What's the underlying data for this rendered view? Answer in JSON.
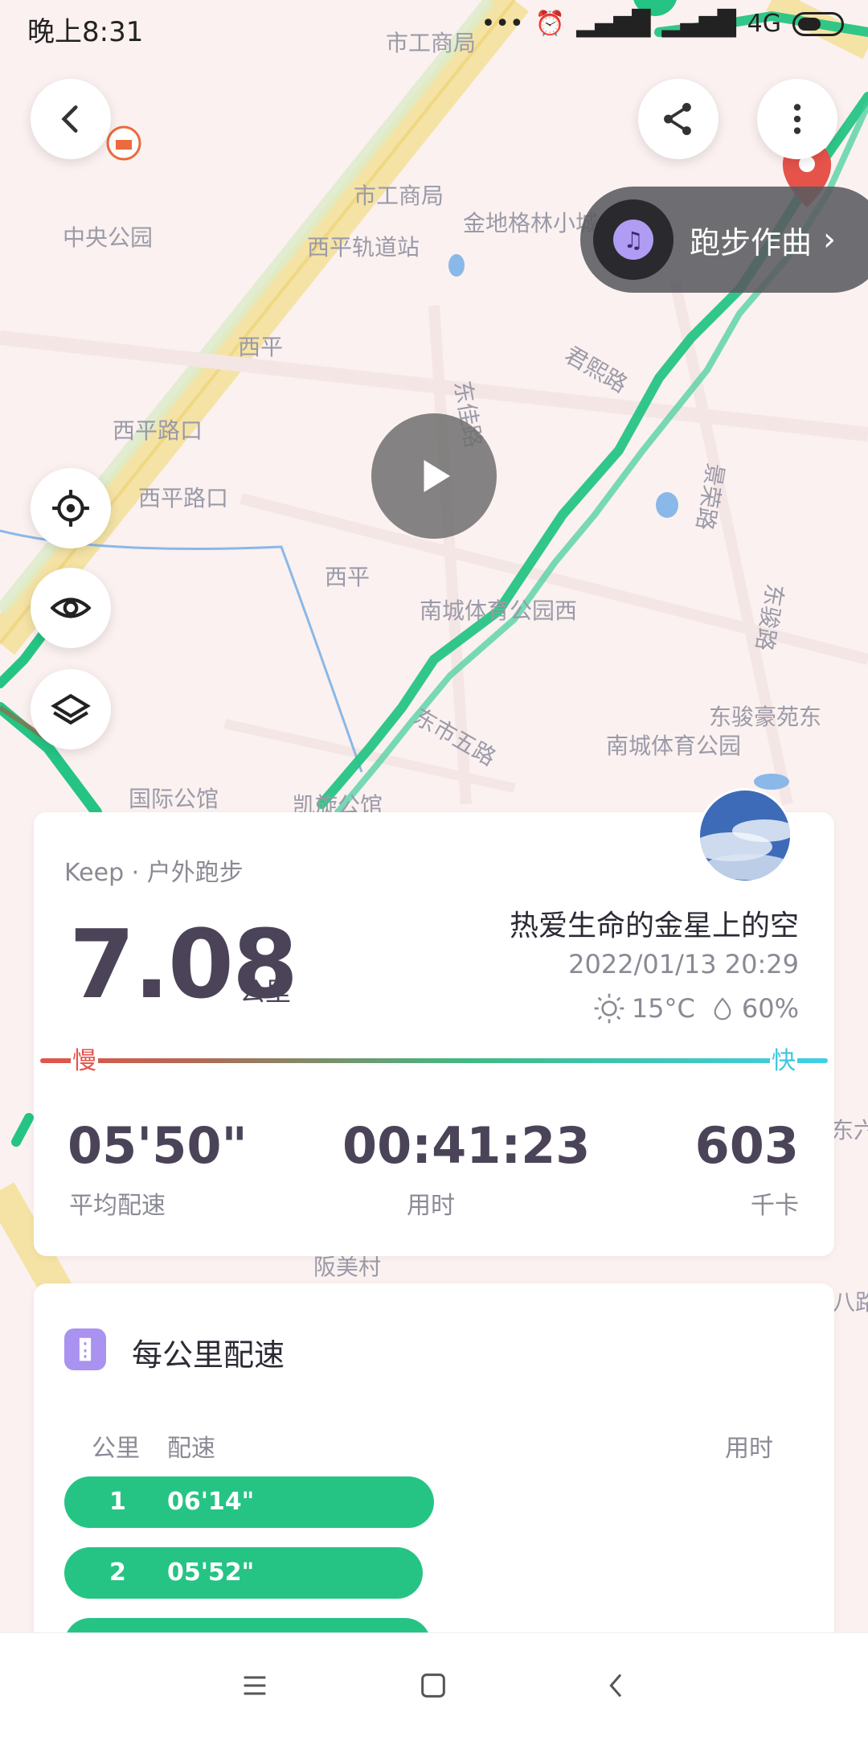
{
  "status_bar": {
    "time": "晚上8:31",
    "network": "4G"
  },
  "map": {
    "labels": [
      "市工商局",
      "市工商局",
      "中央公园",
      "西平轨道站",
      "金地格林小城",
      "西平",
      "君熙路",
      "西平路口",
      "西平路口",
      "东佳路",
      "景荣路",
      "西平",
      "南城体育公园西",
      "东骏路",
      "东市五路",
      "东骏豪苑东",
      "南城体育公园",
      "国际公馆",
      "凯旋公馆",
      "东六路",
      "八路",
      "阪美村"
    ]
  },
  "music": {
    "label": "跑步作曲"
  },
  "summary": {
    "source": "Keep · 户外跑步",
    "distance": "7.08",
    "distance_unit": "公里",
    "username": "热爱生命的金星上的空",
    "datetime": "2022/01/13 20:29",
    "temperature": "15°C",
    "humidity": "60%",
    "slow_label": "慢",
    "fast_label": "快",
    "stats": [
      {
        "value": "05'50\"",
        "label": "平均配速"
      },
      {
        "value": "00:41:23",
        "label": "用时"
      },
      {
        "value": "603",
        "label": "千卡"
      }
    ]
  },
  "per_km": {
    "title": "每公里配速",
    "headers": {
      "km": "公里",
      "pace": "配速",
      "time": "用时"
    },
    "rows": [
      {
        "km": "1",
        "pace": "06'14\""
      },
      {
        "km": "2",
        "pace": "05'52\""
      },
      {
        "km": "",
        "pace": ""
      }
    ]
  },
  "colors": {
    "route": "#26c484",
    "accent_purple": "#a992f0",
    "slow": "#e5534b",
    "fast": "#3fc6e0"
  }
}
